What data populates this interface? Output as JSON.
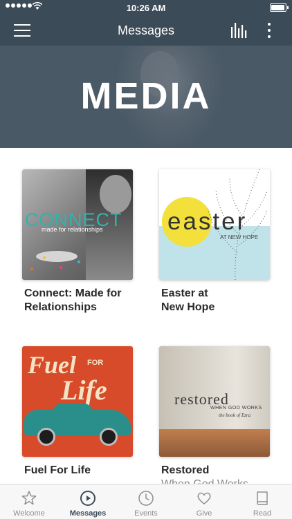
{
  "status_bar": {
    "time": "10:26 AM"
  },
  "nav": {
    "title": "Messages"
  },
  "hero": {
    "title": "MEDIA"
  },
  "cards": [
    {
      "title_line1": "Connect: Made for",
      "title_line2": "Relationships",
      "art": {
        "big": "CONNECT",
        "small": "made for relationships"
      }
    },
    {
      "title_line1": "Easter at",
      "title_line2": "New Hope",
      "art": {
        "word": "easter",
        "sub": "AT NEW HOPE"
      }
    },
    {
      "title_line1": "Fuel For Life",
      "title_line2": "",
      "art": {
        "word1": "Fuel",
        "word2": "FOR",
        "word3": "Life"
      }
    },
    {
      "title_line1": "Restored",
      "title_line2": "When God Works",
      "art": {
        "word": "restored",
        "sub1": "WHEN GOD WORKS",
        "sub2": "the book of Ezra"
      }
    }
  ],
  "tabs": [
    {
      "label": "Welcome",
      "icon": "star-icon"
    },
    {
      "label": "Messages",
      "icon": "play-circle-icon"
    },
    {
      "label": "Events",
      "icon": "clock-icon"
    },
    {
      "label": "Give",
      "icon": "heart-icon"
    },
    {
      "label": "Read",
      "icon": "book-icon"
    }
  ],
  "colors": {
    "nav_bg": "#3c4b58",
    "active_tab": "#3c4b58",
    "inactive_tab": "#8f8f8f"
  }
}
